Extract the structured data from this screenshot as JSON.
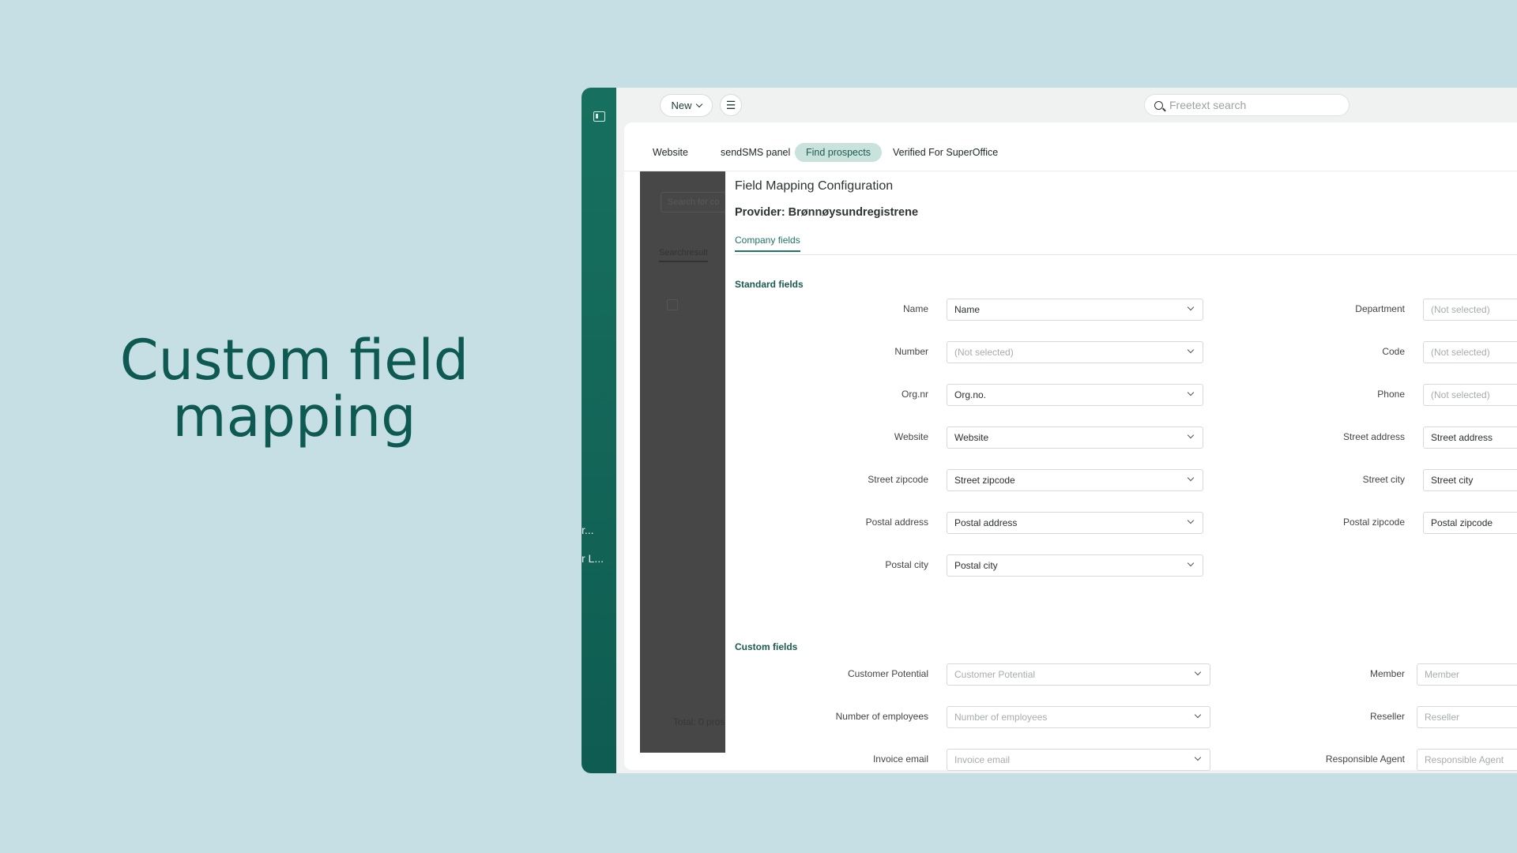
{
  "hero": {
    "line1": "Custom field",
    "line2": "mapping"
  },
  "sidebar": {
    "truncated": [
      "r...",
      "r L..."
    ]
  },
  "topbar": {
    "new_label": "New",
    "search_placeholder": "Freetext search"
  },
  "tabs": [
    {
      "label": "Website"
    },
    {
      "label": "sendSMS panel"
    },
    {
      "label": "Find prospects",
      "active": true
    },
    {
      "label": "Verified For SuperOffice"
    }
  ],
  "background_panel": {
    "search_placeholder": "Search for co",
    "tab_label": "Searchresult",
    "total_label": "Total: 0 pros"
  },
  "modal": {
    "title": "Field Mapping Configuration",
    "provider": "Provider: Brønnøysundregistrene",
    "subtab": "Company fields",
    "standard_title": "Standard fields",
    "custom_title": "Custom fields",
    "standard_left": [
      {
        "label": "Name",
        "value": "Name",
        "placeholder": false
      },
      {
        "label": "Number",
        "value": "(Not selected)",
        "placeholder": true
      },
      {
        "label": "Org.nr",
        "value": "Org.no.",
        "placeholder": false
      },
      {
        "label": "Website",
        "value": "Website",
        "placeholder": false
      },
      {
        "label": "Street zipcode",
        "value": "Street zipcode",
        "placeholder": false
      },
      {
        "label": "Postal address",
        "value": "Postal address",
        "placeholder": false
      },
      {
        "label": "Postal city",
        "value": "Postal city",
        "placeholder": false
      }
    ],
    "standard_right": [
      {
        "label": "Department",
        "value": "(Not selected)",
        "placeholder": true
      },
      {
        "label": "Code",
        "value": "(Not selected)",
        "placeholder": true
      },
      {
        "label": "Phone",
        "value": "(Not selected)",
        "placeholder": true
      },
      {
        "label": "Street address",
        "value": "Street address",
        "placeholder": false
      },
      {
        "label": "Street city",
        "value": "Street city",
        "placeholder": false
      },
      {
        "label": "Postal zipcode",
        "value": "Postal zipcode",
        "placeholder": false
      }
    ],
    "custom_left": [
      {
        "label": "Customer Potential",
        "value": "Customer Potential",
        "placeholder": true
      },
      {
        "label": "Number of employees",
        "value": "Number of employees",
        "placeholder": true
      },
      {
        "label": "Invoice email",
        "value": "Invoice email",
        "placeholder": true
      }
    ],
    "custom_right": [
      {
        "label": "Member",
        "value": "Member",
        "placeholder": true
      },
      {
        "label": "Reseller",
        "value": "Reseller",
        "placeholder": true
      },
      {
        "label": "Responsible Agent",
        "value": "Responsible Agent",
        "placeholder": true
      }
    ]
  }
}
